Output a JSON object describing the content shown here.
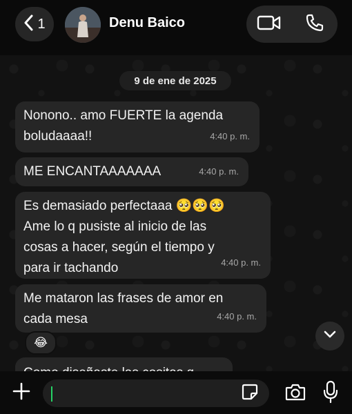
{
  "header": {
    "back_count": "1",
    "contact_name": "Denu Baico"
  },
  "date_chip": "9 de ene de 2025",
  "messages": [
    {
      "text": "Nonono.. amo FUERTE la agenda\nboludaaaa!!",
      "time": "4:40 p. m."
    },
    {
      "text": "ME ENCANTAAAAAAA",
      "time": "4:40 p. m."
    },
    {
      "text": "Es demasiado perfectaaa 🥺🥺🥺\nAme lo q pusiste al inicio de las\ncosas a hacer, según el tiempo y\npara ir tachando",
      "time": "4:40 p. m."
    },
    {
      "text": "Me mataron las frases de amor en\ncada mesa",
      "time": "4:40 p. m.",
      "reaction": "😂"
    },
    {
      "text": "Como diseñaste las cositas q"
    }
  ],
  "composer": {
    "value": "",
    "placeholder": ""
  },
  "icons": {
    "back": "chevron-left-icon",
    "video": "video-camera-icon",
    "phone": "phone-icon",
    "plus": "plus-icon",
    "sticker": "sticker-icon",
    "camera": "camera-icon",
    "mic": "microphone-icon",
    "scroll": "chevron-down-icon"
  },
  "colors": {
    "accent": "#25d366",
    "bubble": "#262626",
    "background": "#0b0b0b"
  }
}
